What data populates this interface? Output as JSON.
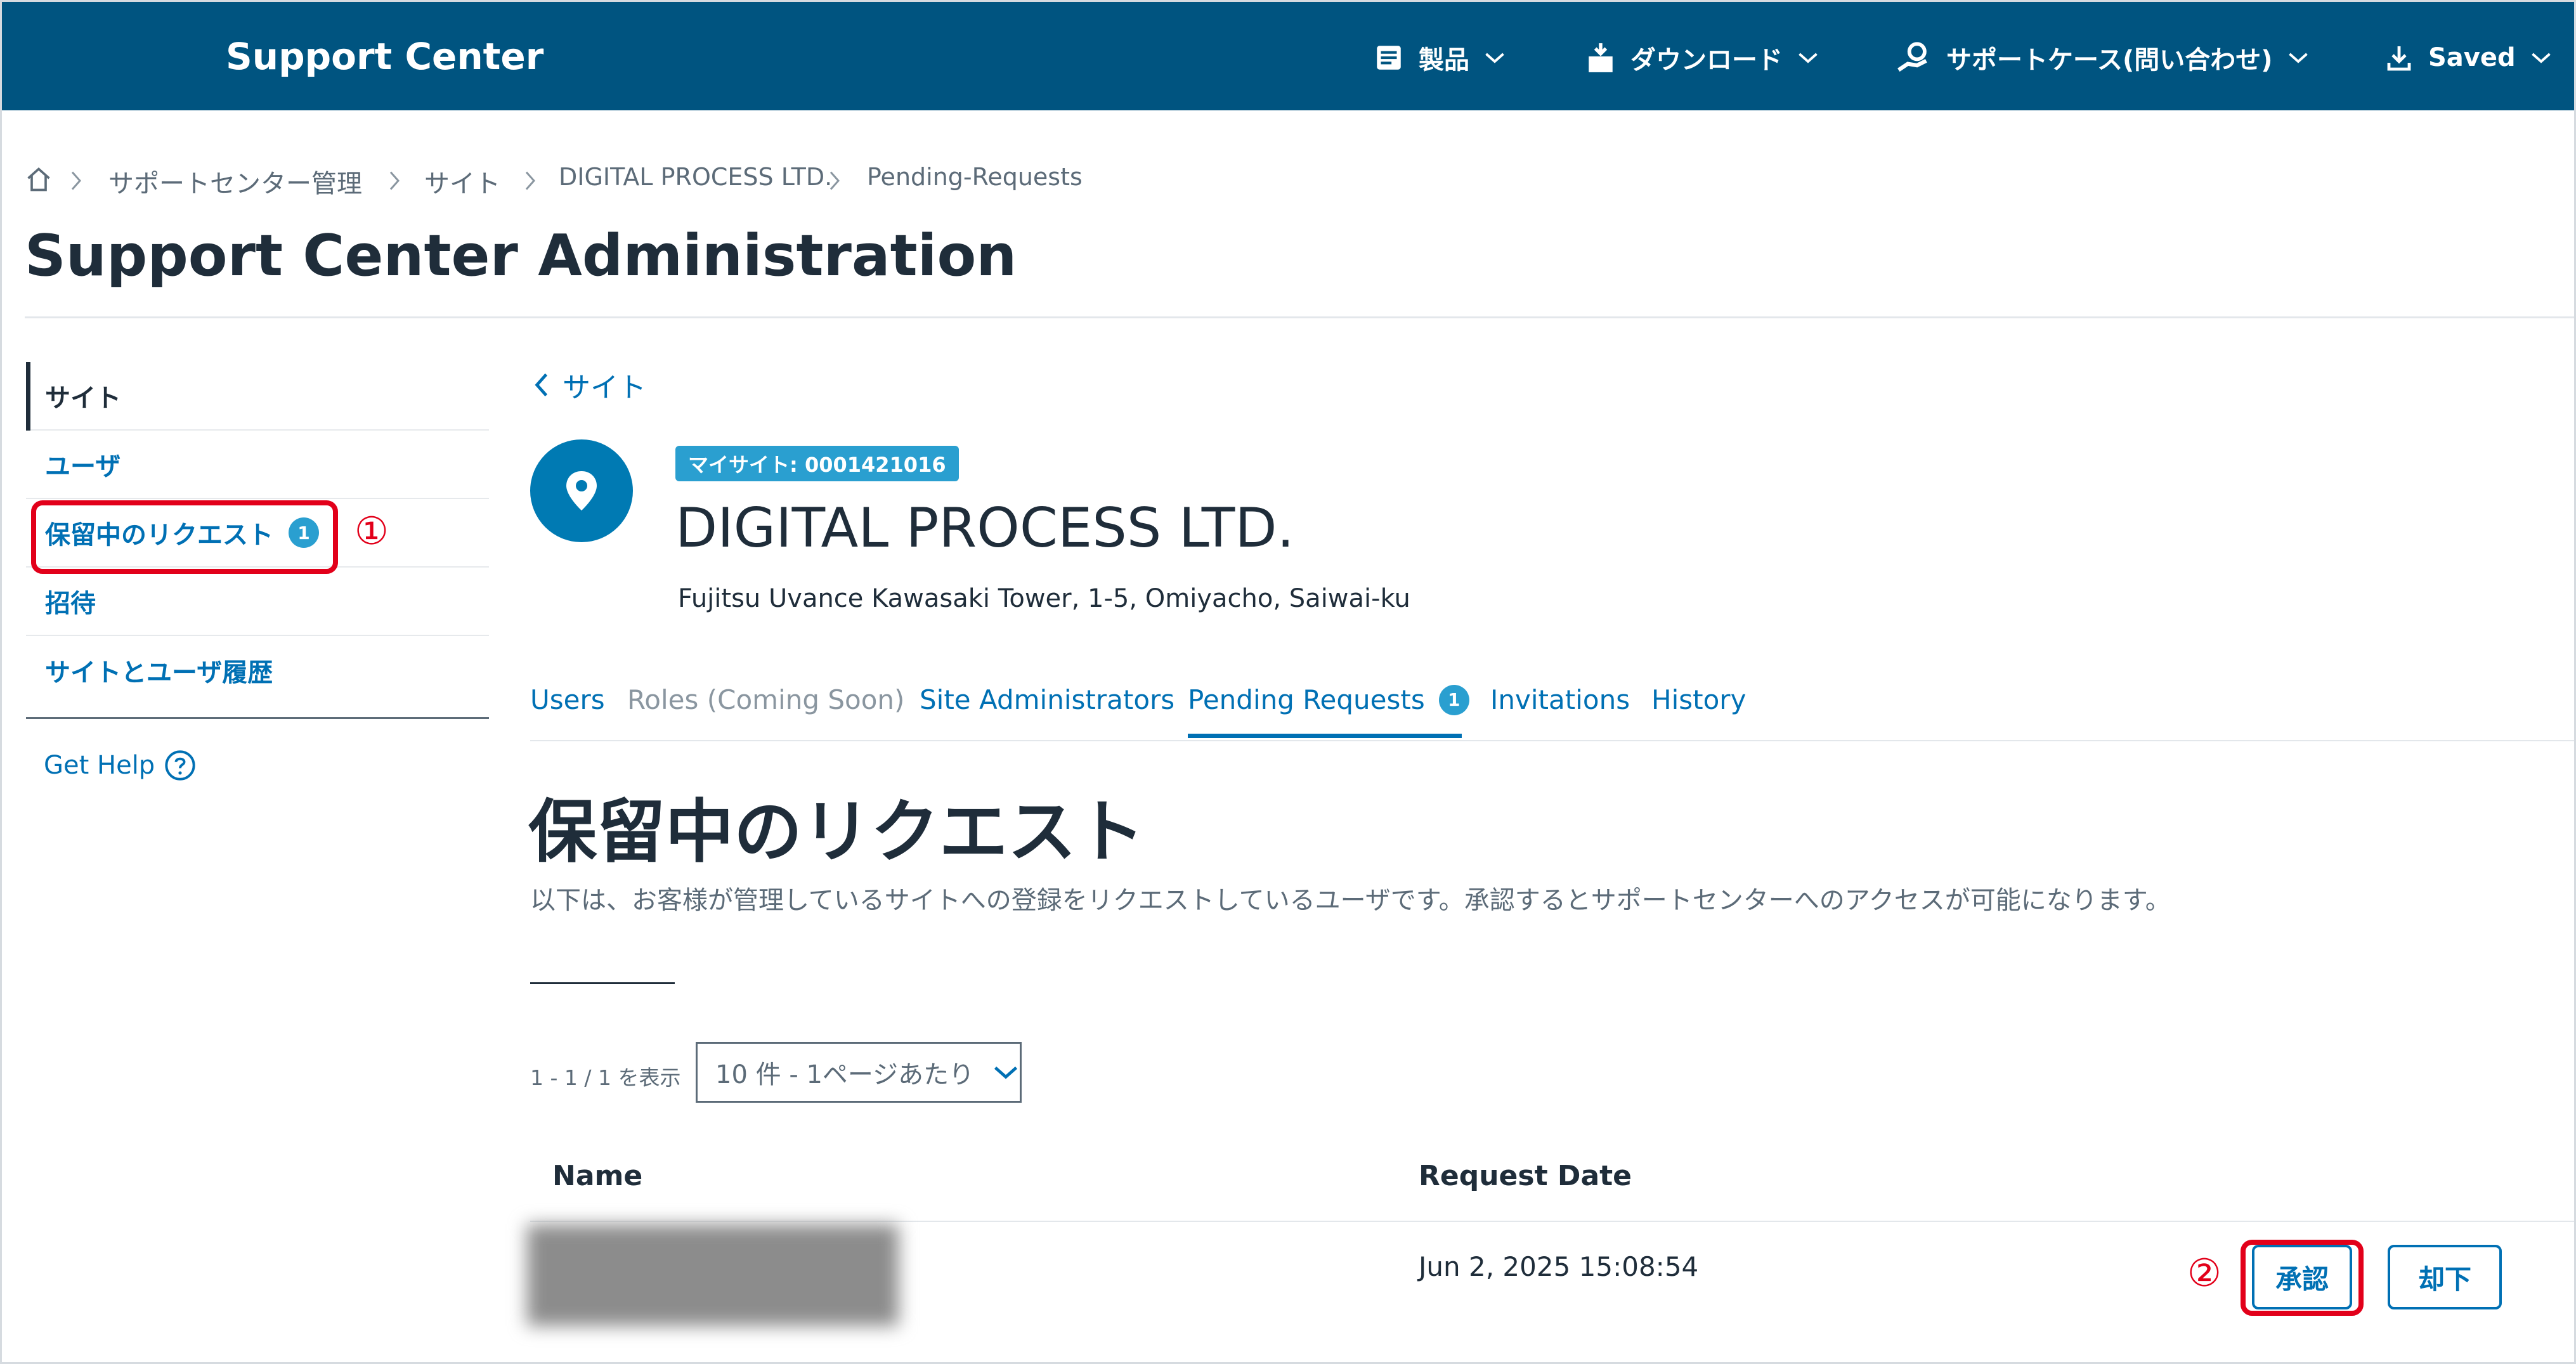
{
  "header": {
    "brand": "Support Center",
    "nav": [
      {
        "label": "製品",
        "icon": "product-list-icon"
      },
      {
        "label": "ダウンロード",
        "icon": "download-box-icon"
      },
      {
        "label": "サポートケース(問い合わせ)",
        "icon": "support-hand-icon"
      },
      {
        "label": "Saved",
        "icon": "download-arrow-icon"
      }
    ]
  },
  "breadcrumb": [
    "サポートセンター管理",
    "サイト",
    "DIGITAL PROCESS LTD.",
    "Pending-Requests"
  ],
  "page_title": "Support Center Administration",
  "sidebar": {
    "items": [
      {
        "label": "サイト",
        "active": true
      },
      {
        "label": "ユーザ"
      },
      {
        "label": "保留中のリクエスト",
        "badge": "1"
      },
      {
        "label": "招待"
      },
      {
        "label": "サイトとユーザ履歴"
      }
    ],
    "help": "Get Help"
  },
  "annotations": {
    "step1": "①",
    "step2": "②"
  },
  "site": {
    "back_label": "サイト",
    "tag": "マイサイト: 0001421016",
    "name": "DIGITAL PROCESS LTD.",
    "address": "Fujitsu Uvance Kawasaki Tower, 1-5, Omiyacho, Saiwai-ku"
  },
  "tabs": [
    {
      "label": "Users"
    },
    {
      "label": "Roles (Coming Soon)",
      "disabled": true
    },
    {
      "label": "Site Administrators"
    },
    {
      "label": "Pending Requests",
      "badge": "1",
      "active": true
    },
    {
      "label": "Invitations"
    },
    {
      "label": "History"
    }
  ],
  "section": {
    "title": "保留中のリクエスト",
    "description": "以下は、お客様が管理しているサイトへの登録をリクエストしているユーザです。承認するとサポートセンターへのアクセスが可能になります。"
  },
  "pagination": {
    "count_text": "1 - 1 / 1 を表示",
    "page_size": "10 件 - 1ページあたり"
  },
  "table": {
    "columns": [
      "Name",
      "Request Date"
    ],
    "rows": [
      {
        "name": "",
        "date": "Jun 2, 2025 15:08:54",
        "approve": "承認",
        "reject": "却下"
      }
    ]
  },
  "colors": {
    "primary": "#005480",
    "accent": "#0070b4",
    "highlight": "#e2001a",
    "badge": "#2a9fd0"
  }
}
